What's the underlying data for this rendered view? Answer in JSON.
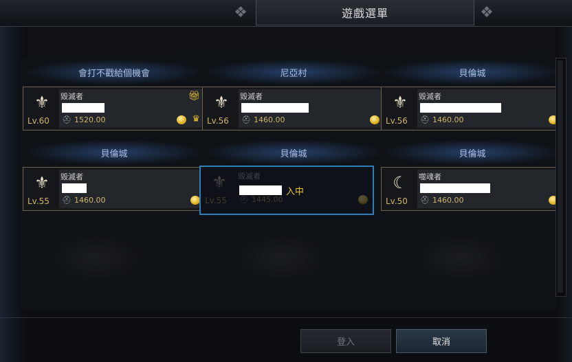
{
  "window": {
    "title": "遊戲選單"
  },
  "slots": [
    {
      "server": "會打不戳給個機會",
      "class": "毀滅者",
      "level": "Lv.60",
      "gear": "1520.00",
      "gift": true,
      "crown": true,
      "name_width": 62
    },
    {
      "server": "尼亞村",
      "class": "毀滅者",
      "level": "Lv.56",
      "gear": "1460.00",
      "gift": false,
      "crown": false,
      "name_width": 98
    },
    {
      "server": "貝倫城",
      "class": "毀滅者",
      "level": "Lv.56",
      "gear": "1460.00",
      "gift": false,
      "crown": false,
      "name_width": 118
    },
    {
      "server": "貝倫城",
      "class": "毀滅者",
      "level": "Lv.55",
      "gear": "1460.00",
      "gift": false,
      "crown": false,
      "name_width": 36
    },
    {
      "server": "貝倫城",
      "class": "毀滅者",
      "level": "Lv.55",
      "gear": "1445.00",
      "status": "入中",
      "selected": true,
      "name_width": 62
    },
    {
      "server": "貝倫城",
      "class": "噬魂者",
      "level": "Lv.50",
      "gear": "1460.00",
      "gift": false,
      "crown": false,
      "name_width": 102
    }
  ],
  "buttons": {
    "login": "登入",
    "cancel": "取消"
  },
  "colors": {
    "accent": "#2c7fb8",
    "gold": "#d2b56a",
    "server": "#a9bde0"
  }
}
